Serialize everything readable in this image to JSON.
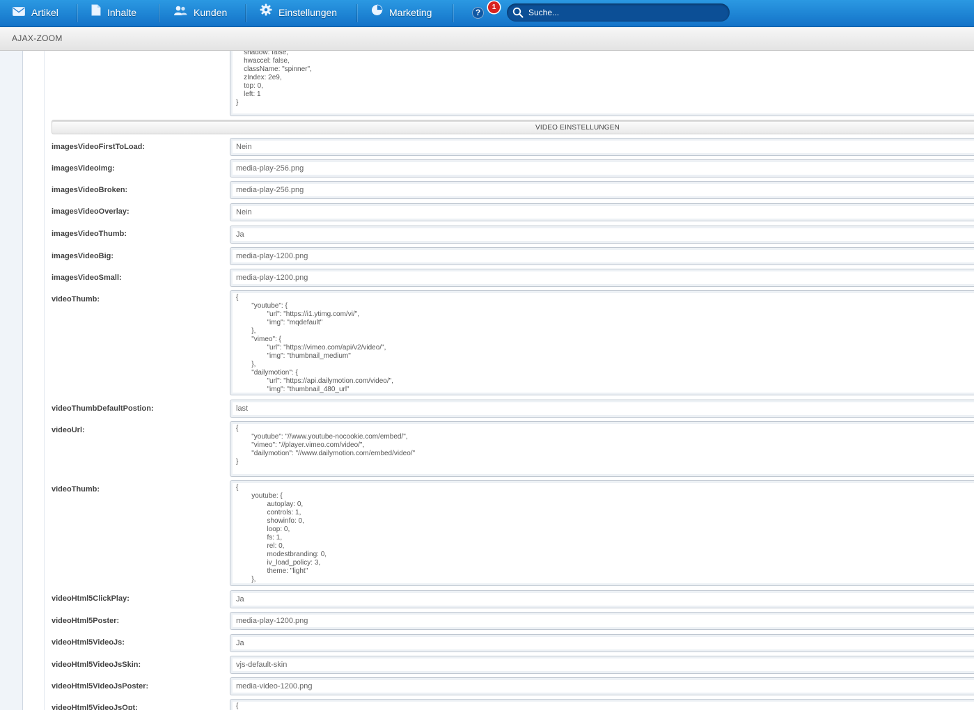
{
  "nav": {
    "items": [
      {
        "label": "Artikel",
        "icon": "mail-icon"
      },
      {
        "label": "Inhalte",
        "icon": "document-icon"
      },
      {
        "label": "Kunden",
        "icon": "users-icon"
      },
      {
        "label": "Einstellungen",
        "icon": "gear-icon"
      },
      {
        "label": "Marketing",
        "icon": "pie-chart-icon"
      }
    ],
    "help_label": "?",
    "notification_count": "1",
    "search_placeholder": "Suche..."
  },
  "window": {
    "title": "AJAX-ZOOM"
  },
  "code_top": {
    "text": "    shadow: false,\n    hwaccel: false,\n    className: \"spinner\",\n    zIndex: 2e9,\n    top: 0,\n    left: 1\n}"
  },
  "section": {
    "title": "VIDEO EINSTELLUNGEN"
  },
  "fields": [
    {
      "label": "imagesVideoFirstToLoad:",
      "value": "Nein"
    },
    {
      "label": "imagesVideoImg:",
      "value": "media-play-256.png"
    },
    {
      "label": "imagesVideoBroken:",
      "value": "media-play-256.png"
    },
    {
      "label": "imagesVideoOverlay:",
      "value": "Nein"
    },
    {
      "label": "imagesVideoThumb:",
      "value": "Ja"
    },
    {
      "label": "imagesVideoBig:",
      "value": "media-play-1200.png"
    },
    {
      "label": "imagesVideoSmall:",
      "value": "media-play-1200.png"
    },
    {
      "label": "videoThumb:",
      "value": "{\n        \"youtube\": {\n                \"url\": \"https://i1.ytimg.com/vi/\",\n                \"img\": \"mqdefault\"\n        },\n        \"vimeo\": {\n                \"url\": \"https://vimeo.com/api/v2/video/\",\n                \"img\": \"thumbnail_medium\"\n        },\n        \"dailymotion\": {\n                \"url\": \"https://api.dailymotion.com/video/\",\n                \"img\": \"thumbnail_480_url\""
    },
    {
      "label": "videoThumbDefaultPostion:",
      "value": "last"
    },
    {
      "label": "videoUrl:",
      "value": "{\n        \"youtube\": \"//www.youtube-nocookie.com/embed/\",\n        \"vimeo\": \"//player.vimeo.com/video/\",\n        \"dailymotion\": \"//www.dailymotion.com/embed/video/\"\n}"
    },
    {
      "label": "videoThumb:",
      "value": "{\n        youtube: {\n                autoplay: 0,\n                controls: 1,\n                showinfo: 0,\n                loop: 0,\n                fs: 1,\n                rel: 0,\n                modestbranding: 0,\n                iv_load_policy: 3,\n                theme: \"light\"\n        },"
    },
    {
      "label": "videoHtml5ClickPlay:",
      "value": "Ja"
    },
    {
      "label": "videoHtml5Poster:",
      "value": "media-play-1200.png"
    },
    {
      "label": "videoHtml5VideoJs:",
      "value": "Ja"
    },
    {
      "label": "videoHtml5VideoJsSkin:",
      "value": "vjs-default-skin"
    },
    {
      "label": "videoHtml5VideoJsPoster:",
      "value": "media-video-1200.png"
    },
    {
      "label": "videoHtml5VideoJsOpt:",
      "value": "{"
    }
  ]
}
